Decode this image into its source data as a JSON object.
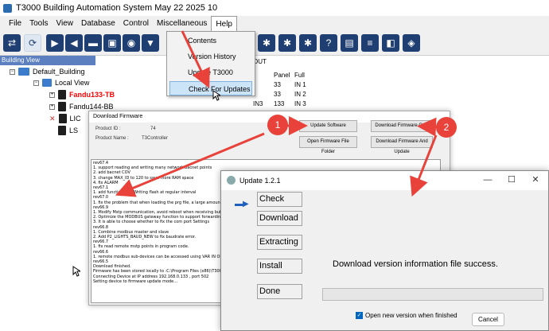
{
  "window": {
    "title": "T3000 Building Automation System     May 22 2025 10"
  },
  "menubar": {
    "items": [
      "File",
      "Tools",
      "View",
      "Database",
      "Control",
      "Miscellaneous",
      "Help"
    ]
  },
  "building_view": {
    "header": "Building View",
    "root": "Default_Building",
    "local": "Local View",
    "devices": [
      {
        "label": "Fandu133-TB",
        "color": "#ff0000"
      },
      {
        "label": "Fandu144-BB",
        "color": "#000000"
      },
      {
        "label": "LIC",
        "color": "#000000"
      },
      {
        "label": "LS",
        "color": "#000000"
      }
    ]
  },
  "table": {
    "headers": [
      "OUT",
      "Panel",
      "Full"
    ],
    "rows": [
      {
        "panel": "33",
        "full": "IN 1"
      },
      {
        "panel": "33",
        "full": "IN 2"
      },
      {
        "label": "IN3",
        "panel": "133",
        "full": "IN 3"
      }
    ]
  },
  "help_menu": {
    "items": [
      "Contents",
      "Version History",
      "Update T3000",
      "Check For Updates"
    ],
    "selected": "Check For Updates"
  },
  "firmware_dialog": {
    "title": "Download Firmware",
    "product_id_label": "Product ID :",
    "product_id_value": "74",
    "product_name_label": "Product Name :",
    "product_name_value": "T3Controller",
    "buttons": {
      "update_software": "Update Software",
      "download_only": "Download Firmware Only",
      "open_folder": "Open Firmware File Folder",
      "download_update": "Download Firmware And Update"
    },
    "log": [
      "rev67.4",
      "1. support reading and writing many network bacnet points",
      "2. add bacnet COV",
      "3. change MAX_ID to 120 to save more RAM space",
      "4. fix ALARM",
      "rev67.1",
      "1. add function that Writing flash at regular interval",
      "rev67.0",
      "1. fix the problem that when loading the prg file, a large amount of written data w...",
      "rev66.9",
      "1. Modify Mstp communication, avoid reboot when receiving buf overflow.",
      "2. Optimize the MODBUS gateway function to support forwarding to two serial por...",
      "3. It is able to choose whether to fix the com port Settings",
      "rev66.8",
      "1. Combine modbus master and slave",
      "2. Add P2_LIGHTS_BAUD_NEW to fix baudrate error.",
      "rev66.7",
      "1. fix read remote mstp points in program code.",
      "rev66.6",
      "1. remote modbus sub-devices can be accessed using VAR IN OUT",
      "rev66.5",
      "Download finished.",
      "Firmware has been stored locally to :C:\\Program Files (x86)\\T3000\\Database\\Firm...",
      "Connecting Device at IP address 192.168.0.133 , port 502",
      "Setting device to firmware update mode..."
    ]
  },
  "update_dialog": {
    "title": "Update 1.2.1",
    "steps": [
      "Check",
      "Download",
      "Extracting",
      "Install",
      "Done"
    ],
    "message": "Download version information file success.",
    "progress": 0,
    "checkbox_label": "Open new version when finished",
    "checkbox_checked": true,
    "cancel_label": "Cancel",
    "colors": {
      "progress": "#06b025",
      "checkbox": "#0067c0"
    }
  },
  "annotations": {
    "badges": [
      "1",
      "2"
    ],
    "color": "#e8423a"
  }
}
